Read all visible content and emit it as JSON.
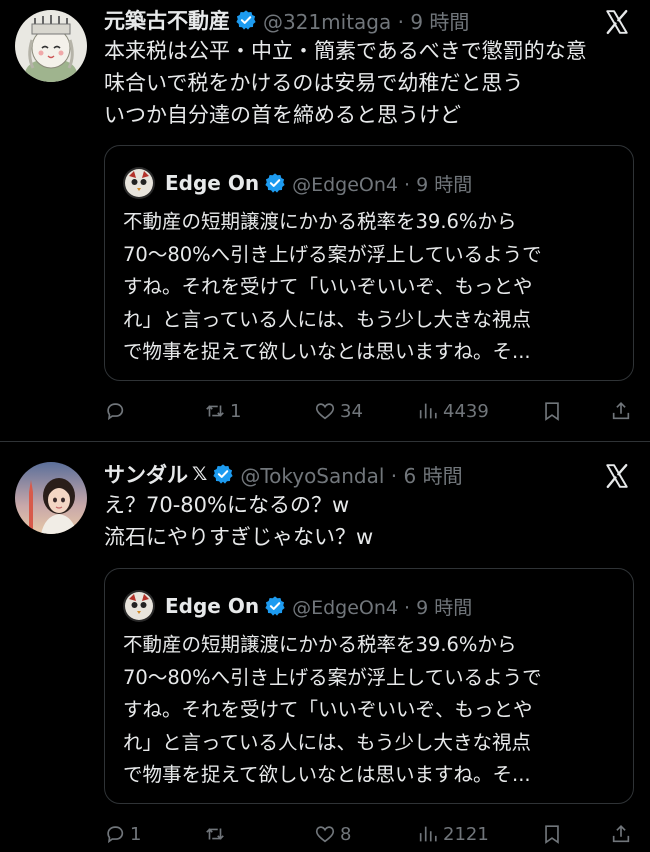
{
  "tweets": [
    {
      "name": "元築古不動産",
      "handle": "@321mitaga · 9 時間",
      "lines": [
        "本来税は公平・中立・簡素であるべきで懲罰的な意",
        "味合いで税をかけるのは安易で幼稚だと思う",
        "いつか自分達の首を締めると思うけど"
      ],
      "quote": {
        "name": "Edge On",
        "handle": "@EdgeOn4 · 9 時間",
        "lines": [
          "不動産の短期譲渡にかかる税率を39.6%から",
          "70〜80%へ引き上げる案が浮上しているようで",
          "すね。それを受けて「いいぞいいぞ、もっとや",
          "れ」と言っている人には、もう少し大きな視点",
          "で物事を捉えて欲しいなとは思いますね。そ..."
        ]
      },
      "stats": {
        "replies": "",
        "retweets": "1",
        "likes": "34",
        "views": "4439"
      }
    },
    {
      "name": "サンダル",
      "badge": "𝕏",
      "handle": "@TokyoSandal · 6 時間",
      "lines": [
        "え？70-80%になるの？w",
        "流石にやりすぎじゃない？w"
      ],
      "quote": {
        "name": "Edge On",
        "handle": "@EdgeOn4 · 9 時間",
        "lines": [
          "不動産の短期譲渡にかかる税率を39.6%から",
          "70〜80%へ引き上げる案が浮上しているようで",
          "すね。それを受けて「いいぞいいぞ、もっとや",
          "れ」と言っている人には、もう少し大きな視点",
          "で物事を捉えて欲しいなとは思いますね。そ..."
        ]
      },
      "stats": {
        "replies": "1",
        "retweets": "",
        "likes": "8",
        "views": "2121"
      }
    }
  ],
  "colors": {
    "background": "#000000",
    "text": "#e7e9ea",
    "muted": "#71767b",
    "verified": "#1d9bf0",
    "border": "#2f3336"
  },
  "icons": [
    "verified-badge-icon",
    "x-logo-icon",
    "reply-icon",
    "retweet-icon",
    "like-icon",
    "views-icon",
    "bookmark-icon",
    "share-icon"
  ]
}
